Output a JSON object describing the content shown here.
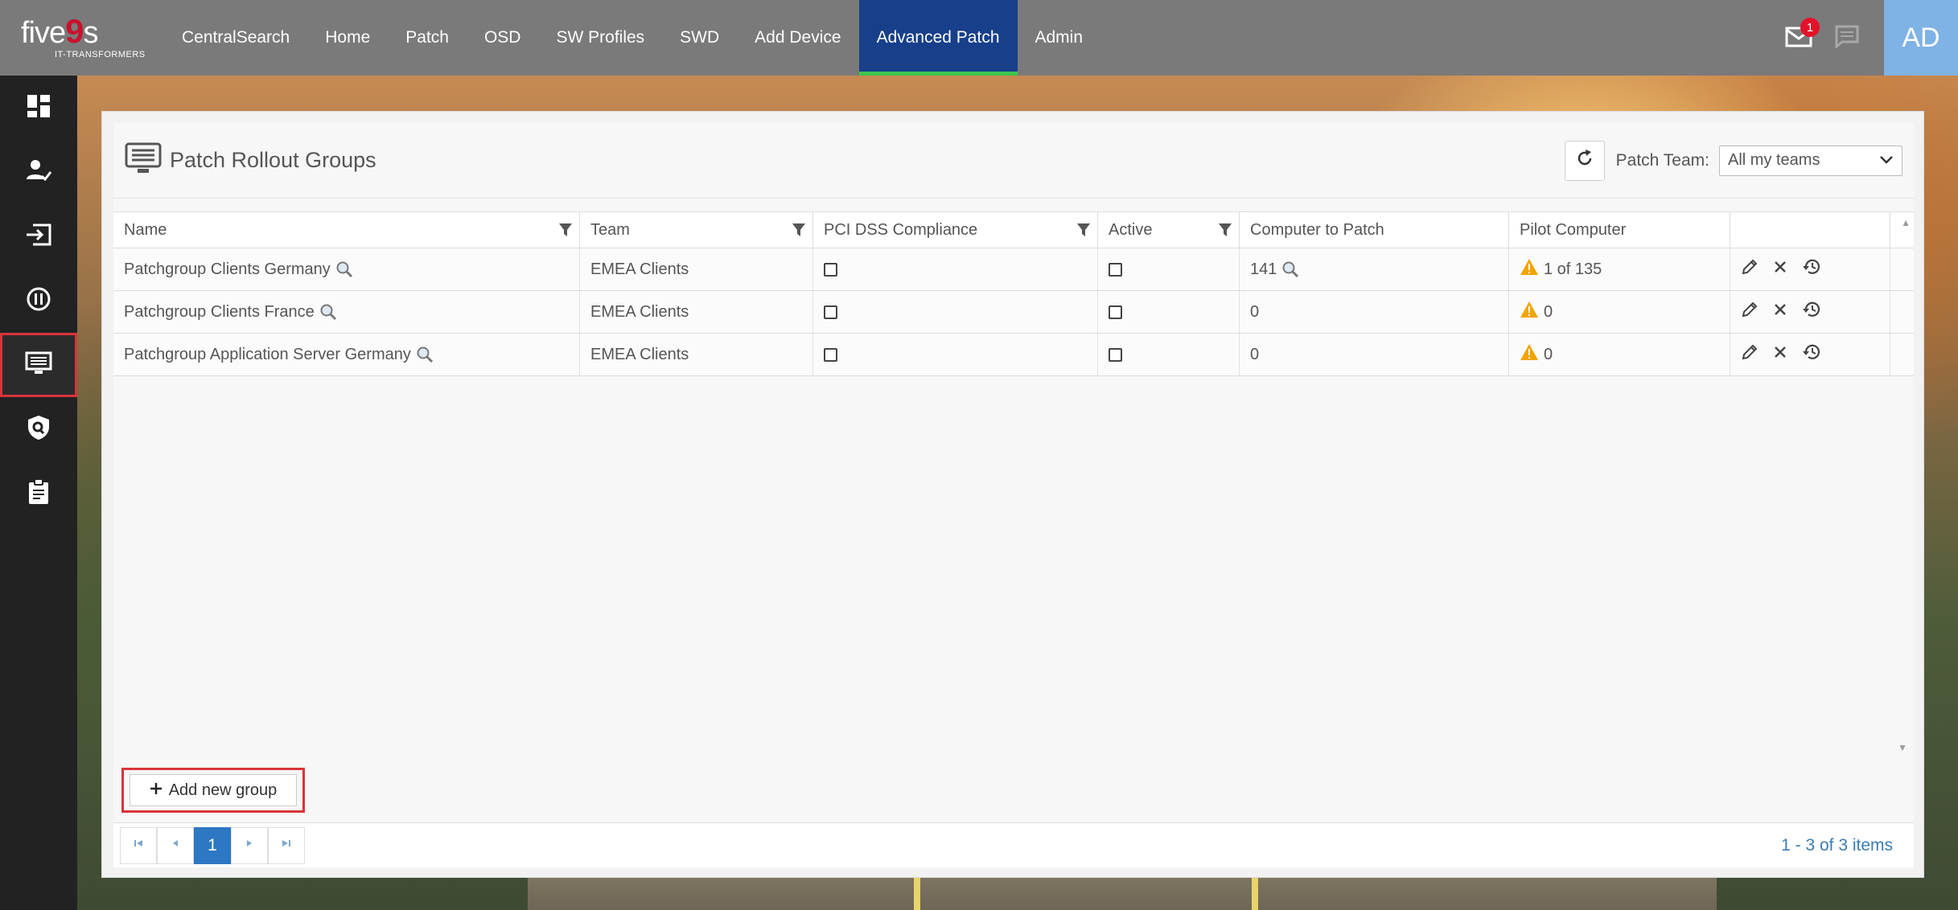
{
  "app": {
    "logo_text_left": "five",
    "logo_text_nine": "9",
    "logo_text_right": "s",
    "logo_tagline": "IT-TRANSFORMERS",
    "nav": [
      {
        "label": "CentralSearch"
      },
      {
        "label": "Home"
      },
      {
        "label": "Patch"
      },
      {
        "label": "OSD"
      },
      {
        "label": "SW Profiles"
      },
      {
        "label": "SWD"
      },
      {
        "label": "Add Device"
      },
      {
        "label": "Advanced Patch",
        "active": true
      },
      {
        "label": "Admin"
      }
    ],
    "notification_count": "1",
    "user_initials": "AD"
  },
  "sidebar": {
    "items": [
      {
        "icon": "dashboard-icon"
      },
      {
        "icon": "user-check-icon"
      },
      {
        "icon": "input-arrow-icon"
      },
      {
        "icon": "pause-circle-icon"
      },
      {
        "icon": "monitor-list-icon",
        "active": true
      },
      {
        "icon": "shield-search-icon"
      },
      {
        "icon": "clipboard-icon"
      }
    ]
  },
  "panel": {
    "title": "Patch Rollout Groups",
    "patch_team_label": "Patch Team:",
    "patch_team_value": "All my teams"
  },
  "table": {
    "columns": [
      "Name",
      "Team",
      "PCI DSS Compliance",
      "Active",
      "Computer to Patch",
      "Pilot Computer"
    ],
    "rows": [
      {
        "name": "Patchgroup Clients Germany",
        "team": "EMEA Clients",
        "computers": "141",
        "pilot": "1 of 135"
      },
      {
        "name": "Patchgroup Clients France",
        "team": "EMEA Clients",
        "computers": "0",
        "pilot": "0"
      },
      {
        "name": "Patchgroup Application Server Germany",
        "team": "EMEA Clients",
        "computers": "0",
        "pilot": "0"
      }
    ]
  },
  "footer": {
    "add_button": "Add new group",
    "current_page": "1",
    "items_info": "1 - 3 of 3 items"
  },
  "colors": {
    "topbar": "#7a7a7a",
    "nav_active": "#173f8a",
    "nav_active_underline": "#3cc54f",
    "sidebar": "#222222",
    "highlight_border": "#d9343a",
    "warning": "#f0a500",
    "pager_active": "#2e77c2"
  }
}
